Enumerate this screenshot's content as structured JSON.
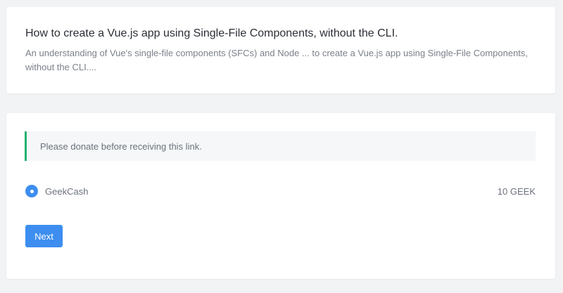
{
  "article": {
    "title": "How to create a Vue.js app using Single-File Components, without the CLI.",
    "description": "An understanding of Vue's single-file components (SFCs) and Node ... to create a Vue.js app using Single-File Components, without the CLI...."
  },
  "donation": {
    "notice": "Please donate before receiving this link.",
    "payment_option": {
      "label": "GeekCash",
      "amount": "10 GEEK",
      "selected": true,
      "icon": "radio-selected-icon"
    },
    "next_label": "Next"
  },
  "colors": {
    "accent": "#3d8ef0",
    "notice_border": "#23b26d",
    "background": "#f2f3f5"
  }
}
